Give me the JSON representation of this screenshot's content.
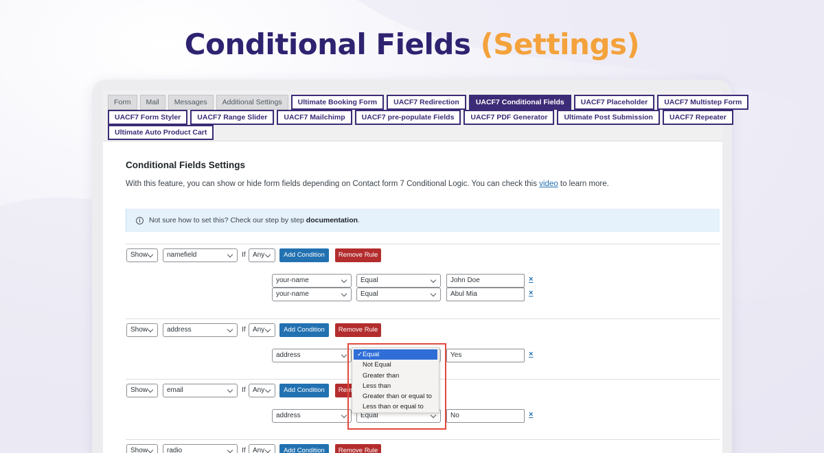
{
  "hero": {
    "title": "Conditional Fields",
    "title_accent": "(Settings)"
  },
  "tabs": {
    "row1": [
      {
        "label": "Form",
        "kind": "plain"
      },
      {
        "label": "Mail",
        "kind": "plain"
      },
      {
        "label": "Messages",
        "kind": "plain"
      },
      {
        "label": "Additional Settings",
        "kind": "plain"
      },
      {
        "label": "Ultimate Booking Form",
        "kind": "ext"
      },
      {
        "label": "UACF7 Redirection",
        "kind": "ext"
      },
      {
        "label": "UACF7 Conditional Fields",
        "kind": "active"
      },
      {
        "label": "UACF7 Placeholder",
        "kind": "ext"
      },
      {
        "label": "UACF7 Multistep Form",
        "kind": "ext"
      }
    ],
    "row2": [
      {
        "label": "UACF7 Form Styler",
        "kind": "ext"
      },
      {
        "label": "UACF7 Range Slider",
        "kind": "ext"
      },
      {
        "label": "UACF7 Mailchimp",
        "kind": "ext"
      },
      {
        "label": "UACF7 pre-populate Fields",
        "kind": "ext"
      },
      {
        "label": "UACF7 PDF Generator",
        "kind": "ext"
      },
      {
        "label": "Ultimate Post Submission",
        "kind": "ext"
      },
      {
        "label": "UACF7 Repeater",
        "kind": "ext"
      }
    ],
    "row3": [
      {
        "label": "Ultimate Auto Product Cart",
        "kind": "ext"
      }
    ]
  },
  "settings": {
    "heading": "Conditional Fields Settings",
    "description_before": "With this feature, you can show or hide form fields depending on Contact form 7 Conditional Logic. You can check this ",
    "description_link": "video",
    "description_after": " to learn more.",
    "notice_text": "Not sure how to set this? Check our step by step ",
    "notice_link": "documentation",
    "notice_end": "."
  },
  "common": {
    "if_label": "If",
    "add_condition": "Add Condition",
    "remove_rule": "Remove Rule",
    "remove_x": "×"
  },
  "rules": [
    {
      "action": "Show",
      "field": "namefield",
      "match": "Any",
      "conditions": [
        {
          "field": "your-name",
          "operator": "Equal",
          "value": "John Doe"
        },
        {
          "field": "your-name",
          "operator": "Equal",
          "value": "Abul Mia"
        }
      ]
    },
    {
      "action": "Show",
      "field": "address",
      "match": "Any",
      "conditions": [
        {
          "field": "address",
          "operator": "Equal",
          "value": "Yes"
        }
      ]
    },
    {
      "action": "Show",
      "field": "email",
      "match": "Any",
      "conditions": [
        {
          "field": "address",
          "operator": "Equal",
          "value": "No"
        }
      ]
    },
    {
      "action": "Show",
      "field": "radio",
      "match": "Any",
      "conditions": []
    }
  ],
  "operator_dropdown": {
    "options": [
      "Equal",
      "Not Equal",
      "Greater than",
      "Less than",
      "Greater than or equal to",
      "Less than or equal to"
    ],
    "selected_index": 0,
    "check_mark": "✓"
  }
}
